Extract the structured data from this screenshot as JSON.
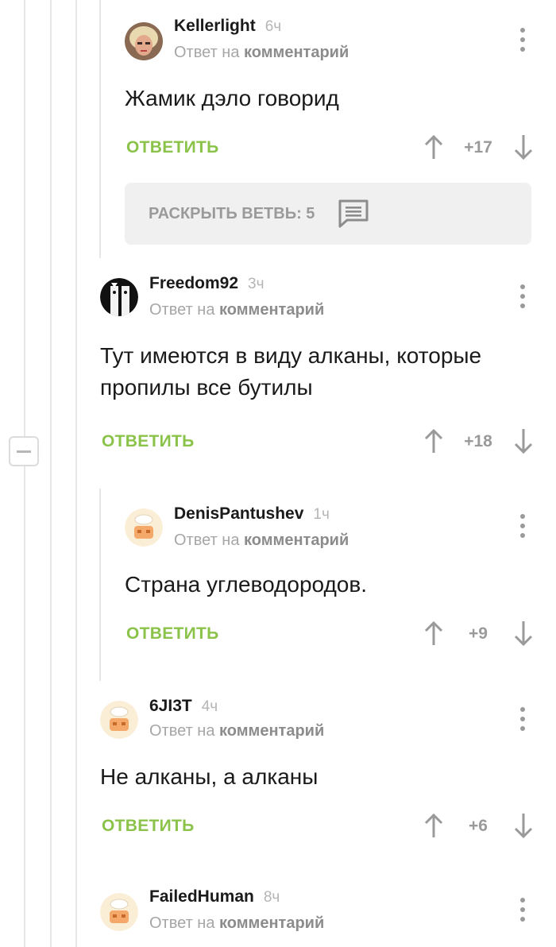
{
  "reply_prefix": "Ответ на",
  "reply_target": "комментарий",
  "reply_label": "ОТВЕТИТЬ",
  "expand_thread": {
    "label": "РАСКРЫТЬ ВЕТВЬ: 5"
  },
  "colors": {
    "accent_green": "#8bc34a",
    "meta_gray": "#a6a6a6",
    "thread_line": "#e6e6e6"
  },
  "comments": [
    {
      "username": "Kellerlight",
      "time": "6ч",
      "text": "Жамик дэло говорид",
      "rating": "+17"
    },
    {
      "username": "Freedom92",
      "time": "3ч",
      "text": "Тут имеются в виду алканы, которые пропилы все бутилы",
      "rating": "+18"
    },
    {
      "username": "DenisPantushev",
      "time": "1ч",
      "text": "Страна углеводородов.",
      "rating": "+9"
    },
    {
      "username": "6JI3T",
      "time": "4ч",
      "text": "Не алканы, а алканы",
      "rating": "+6"
    },
    {
      "username": "FailedHuman",
      "time": "8ч"
    }
  ],
  "icons": [
    "more-vertical-icon",
    "arrow-up-icon",
    "arrow-down-icon",
    "comment-bubble-icon",
    "collapse-minus-icon"
  ]
}
